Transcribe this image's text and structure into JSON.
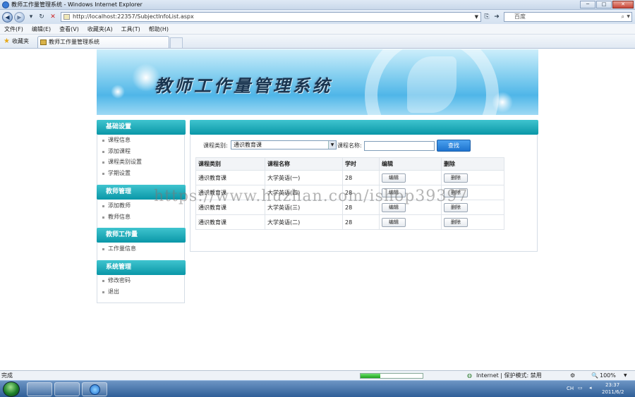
{
  "window": {
    "title": "教师工作量管理系统 - Windows Internet Explorer",
    "minimize": "─",
    "maximize": "□",
    "close": "✕"
  },
  "address": {
    "url": "http://localhost:22357/SubjectInfoList.aspx",
    "search_placeholder": "百度"
  },
  "menu": [
    "文件(F)",
    "编辑(E)",
    "查看(V)",
    "收藏夹(A)",
    "工具(T)",
    "帮助(H)"
  ],
  "favorites": {
    "label": "收藏夹",
    "tab_title": "教师工作量管理系统"
  },
  "banner": {
    "title": "教师工作量管理系统"
  },
  "sidebar": {
    "sections": [
      {
        "title": "基础设置",
        "items": [
          "课程信息",
          "添加课程",
          "课程类别设置",
          "学期设置"
        ]
      },
      {
        "title": "教师管理",
        "items": [
          "添加教师",
          "教师信息"
        ]
      },
      {
        "title": "教师工作量",
        "items": [
          "工作量信息"
        ]
      },
      {
        "title": "系统管理",
        "items": [
          "修改密码",
          "退出"
        ]
      }
    ]
  },
  "filter": {
    "category_label": "课程类别:",
    "category_value": "通识教育课",
    "name_label": "课程名称:",
    "name_value": "",
    "search_button": "查找"
  },
  "table": {
    "headers": [
      "课程类别",
      "课程名称",
      "学时",
      "编辑",
      "删除"
    ],
    "rows": [
      {
        "category": "通识教育课",
        "name": "大学英语(一)",
        "hours": "28",
        "edit": "编辑",
        "del": "删除"
      },
      {
        "category": "通识教育课",
        "name": "大学英语(四)",
        "hours": "28",
        "edit": "编辑",
        "del": "删除"
      },
      {
        "category": "通识教育课",
        "name": "大学英语(三)",
        "hours": "28",
        "edit": "编辑",
        "del": "删除"
      },
      {
        "category": "通识教育课",
        "name": "大学英语(二)",
        "hours": "28",
        "edit": "编辑",
        "del": "删除"
      }
    ]
  },
  "watermark": "https://www.huzhan.com/ishop39397",
  "status": {
    "text": "完成",
    "progress": 0.32,
    "zone": "Internet | 保护模式: 禁用",
    "zoom": "100%"
  },
  "tray": {
    "lang": "CH",
    "time": "23:37",
    "date": "2011/6/2"
  }
}
